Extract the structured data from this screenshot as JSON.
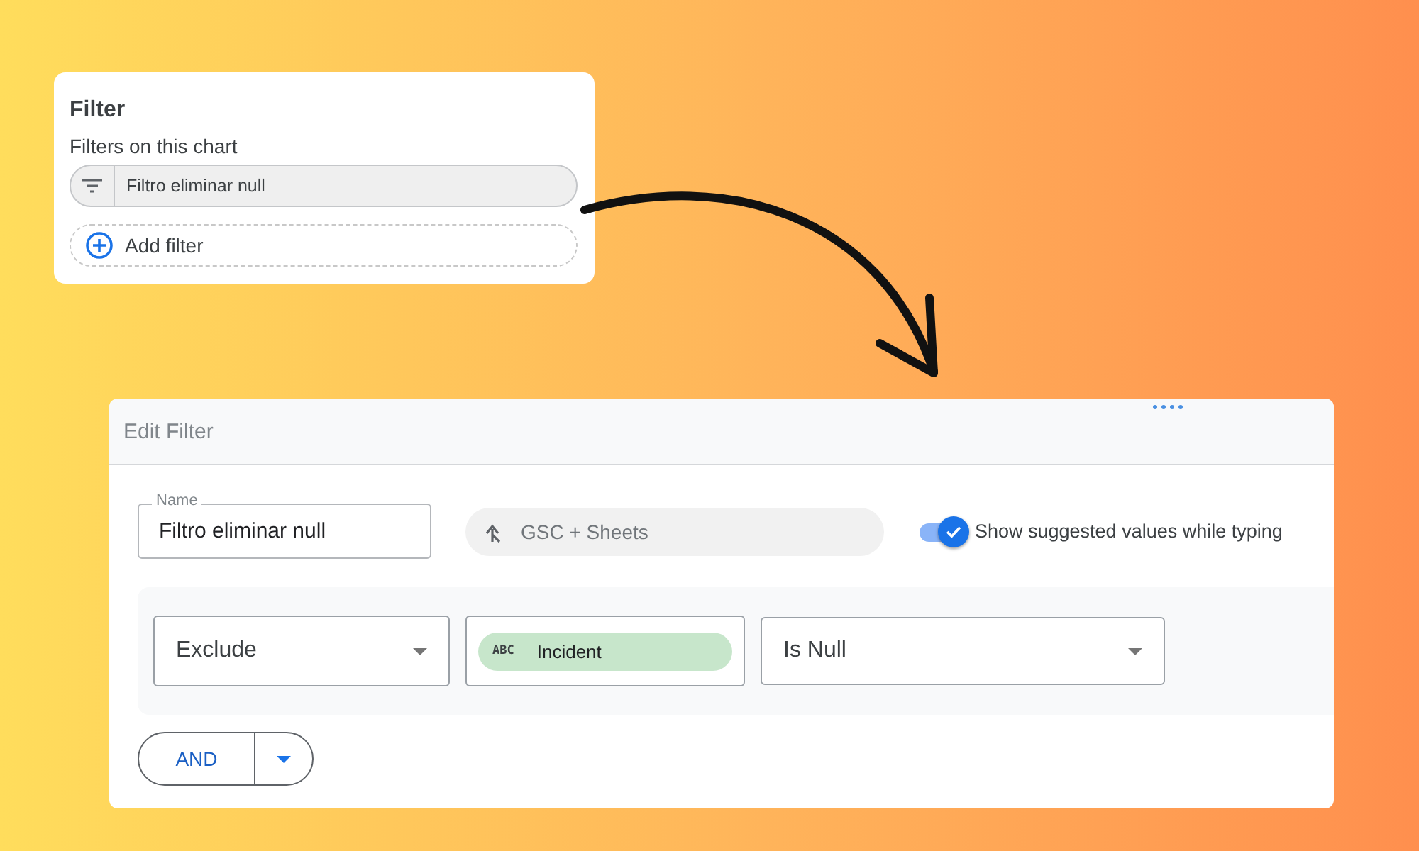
{
  "filter_panel": {
    "title": "Filter",
    "subtitle": "Filters on this chart",
    "filters": [
      {
        "label": "Filtro eliminar null"
      }
    ],
    "add_button": "Add filter"
  },
  "edit_filter": {
    "title": "Edit Filter",
    "name_field": {
      "label": "Name",
      "value": "Filtro eliminar null"
    },
    "data_source": "GSC + Sheets",
    "suggest_toggle": {
      "label": "Show suggested values while typing",
      "on": true
    },
    "condition": {
      "mode": "Exclude",
      "field": {
        "type_badge": "ABC",
        "label": "Incident"
      },
      "operator": "Is Null"
    },
    "and_button": "AND"
  }
}
